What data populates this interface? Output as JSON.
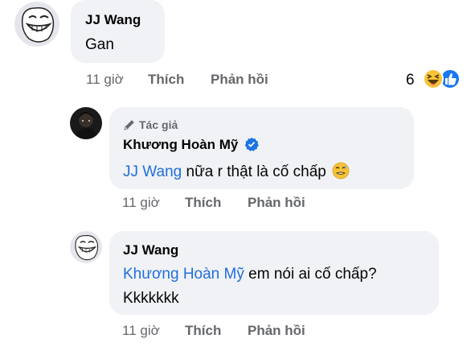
{
  "comments": [
    {
      "author": "JJ Wang",
      "text": "Gan",
      "time": "11 giờ",
      "like_label": "Thích",
      "reply_label": "Phản hồi",
      "reaction_count": "6"
    },
    {
      "author_badge": "Tác giả",
      "author": "Khương Hoàn Mỹ",
      "mention": "JJ Wang",
      "text": "nữa r thật là cố chấp",
      "time": "11 giờ",
      "like_label": "Thích",
      "reply_label": "Phản hồi"
    },
    {
      "author": "JJ Wang",
      "mention": "Khương Hoàn Mỹ",
      "text_line1": "em nói ai cố chấp?",
      "text_line2": "Kkkkkkk",
      "time": "11 giờ",
      "like_label": "Thích",
      "reply_label": "Phản hồi"
    }
  ],
  "colors": {
    "bubble": "#f0f2f5",
    "mention": "#216fdb",
    "meta": "#65676b",
    "verified": "#1b74e4",
    "like_blue": "#1877f2",
    "haha_yellow": "#f7c33a"
  },
  "icons": [
    "troll-face-avatar",
    "profile-photo-avatar",
    "pen-icon",
    "verified-badge-icon",
    "haha-reaction-icon",
    "like-reaction-icon",
    "grimace-emoji"
  ]
}
